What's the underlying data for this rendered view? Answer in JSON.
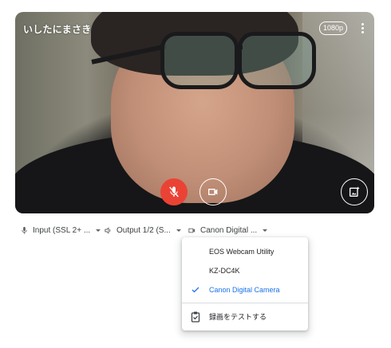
{
  "preview": {
    "participant_name": "いしたにまさき",
    "resolution_badge": "1080p",
    "more_options_icon": "more-vert-icon",
    "mic_button": {
      "icon": "mic-off-icon",
      "state": "muted",
      "color": "#ea4335"
    },
    "camera_button": {
      "icon": "videocam-icon"
    },
    "effects_button": {
      "icon": "visual-effects-icon"
    }
  },
  "devices": {
    "input": {
      "icon": "mic-icon",
      "label": "Input (SSL 2+ ..."
    },
    "output": {
      "icon": "speaker-icon",
      "label": "Output 1/2 (S..."
    },
    "camera": {
      "icon": "videocam-icon",
      "label": "Canon Digital ..."
    }
  },
  "camera_menu": {
    "items": [
      {
        "label": "EOS Webcam Utility",
        "selected": false
      },
      {
        "label": "KZ-DC4K",
        "selected": false
      },
      {
        "label": "Canon Digital Camera",
        "selected": true
      }
    ],
    "test_recording": {
      "icon": "clipboard-icon",
      "label": "録画をテストする"
    },
    "accent_color": "#1a73e8"
  }
}
